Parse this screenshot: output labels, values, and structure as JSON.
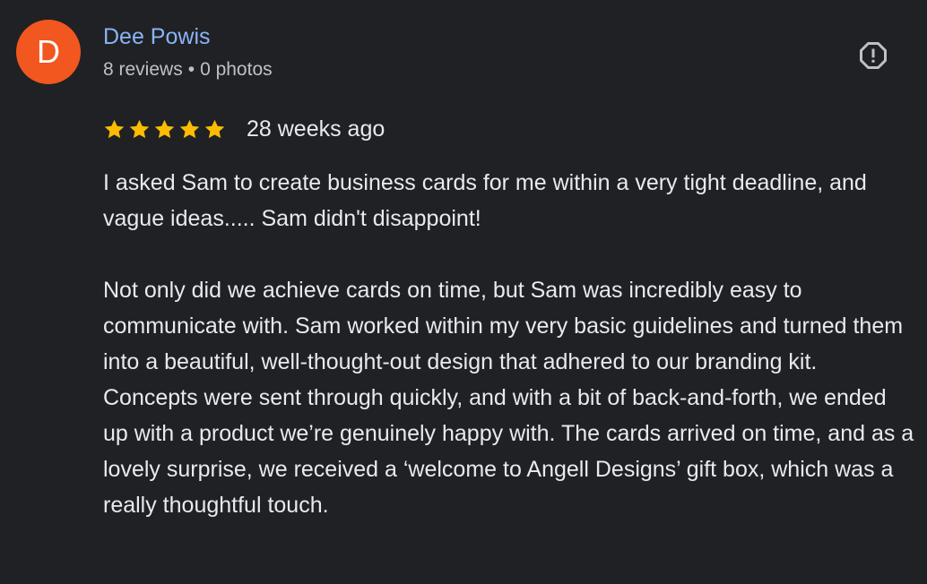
{
  "reviewer": {
    "initial": "D",
    "name": "Dee Powis",
    "reviews_count": "8 reviews",
    "separator": "•",
    "photos_count": "0 photos",
    "avatar_color": "#f1571f"
  },
  "report": {
    "icon": "report-icon"
  },
  "rating": {
    "stars": 5,
    "max_stars": 5,
    "star_color": "#fbbc04",
    "date": "28 weeks ago"
  },
  "review": {
    "paragraphs": [
      "I asked Sam to create business cards for me within a very tight deadline, and vague ideas..... Sam didn't disappoint!",
      "Not only did we achieve cards on time, but Sam was incredibly easy to communicate with. Sam worked within my very basic guidelines and turned them into a beautiful, well-thought-out design that adhered to our branding kit. Concepts were sent through quickly, and with a bit of back-and-forth, we ended up with a product we’re genuinely happy with. The cards arrived on time, and as a lovely surprise, we received a ‘welcome to Angell Designs’ gift box, which was a really thoughtful touch."
    ]
  },
  "colors": {
    "background": "#202124",
    "name_link": "#8ab4f8",
    "secondary_text": "#bdc1c6",
    "primary_text": "#e8eaed"
  }
}
